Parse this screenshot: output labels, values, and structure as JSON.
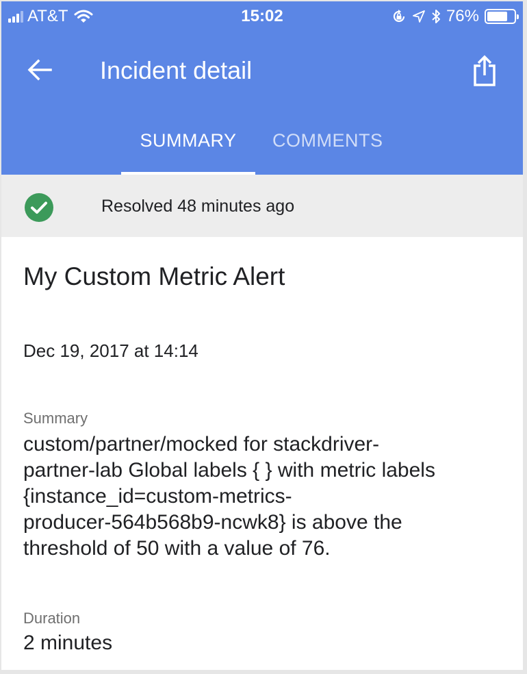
{
  "status_bar": {
    "carrier": "AT&T",
    "time": "15:02",
    "battery_percent": "76%",
    "battery_level": 0.76,
    "icons": [
      "signal-icon",
      "wifi-icon",
      "rotation-lock-icon",
      "location-arrow-icon",
      "bluetooth-icon",
      "battery-icon"
    ]
  },
  "app_bar": {
    "title": "Incident detail",
    "back_icon": "arrow-back-icon",
    "share_icon": "share-icon"
  },
  "tabs": [
    {
      "label": "SUMMARY",
      "active": true
    },
    {
      "label": "COMMENTS",
      "active": false
    }
  ],
  "status_banner": {
    "text": "Resolved 48 minutes ago",
    "icon": "check-circle-icon",
    "icon_color": "#3c9a5a"
  },
  "incident": {
    "title": "My Custom Metric Alert",
    "date": "Dec 19, 2017 at 14:14",
    "summary_label": "Summary",
    "summary_lines": [
      "custom/partner/mocked for stackdriver-",
      "partner-lab Global labels { } with metric labels",
      "{instance_id=custom-metrics-",
      "producer-564b568b9-ncwk8} is above the",
      "threshold of 50 with a value of 76."
    ],
    "duration_label": "Duration",
    "duration": "2 minutes"
  },
  "colors": {
    "app_bar": "#5b86e5",
    "banner_background": "#ededed",
    "text_primary": "#202124",
    "text_secondary": "#6f6f6f"
  }
}
